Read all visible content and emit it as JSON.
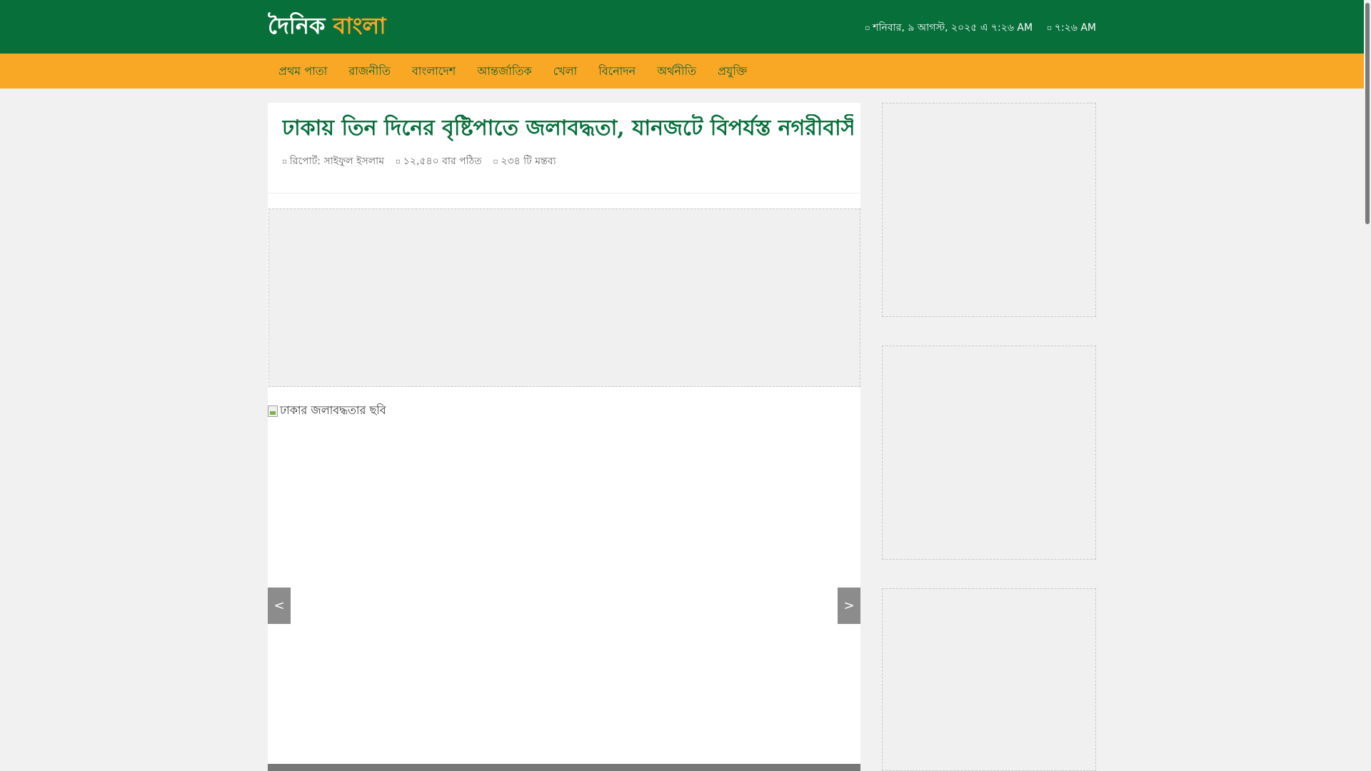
{
  "header": {
    "logo": {
      "part1": "দৈনিক",
      "part2": "বাংলা"
    },
    "date": "শনিবার, ৯ আগস্ট, ২০২৫ এ ৭:২৬ AM",
    "time": "৭:২৬ AM",
    "date_icon": "calendar-icon",
    "time_icon": "clock-icon"
  },
  "nav": {
    "items": [
      "প্রথম পাতা",
      "রাজনীতি",
      "বাংলাদেশ",
      "আন্তর্জাতিক",
      "খেলা",
      "বিনোদন",
      "অর্থনীতি",
      "প্রযুক্তি"
    ]
  },
  "article": {
    "title": "ঢাকায় তিন দিনের বৃষ্টিপাতে জলাবদ্ধতা, যানজটে বিপর্যস্ত নগরীবাসী",
    "reporter": "রিপোর্ট: সাইফুল ইসলাম",
    "views": "১২,৫৪০ বার পঠিত",
    "comments": "২৩৪ টি মন্তব্য",
    "image_alt": "ঢাকার জলাবদ্ধতার ছবি"
  },
  "slider": {
    "prev_label": "<",
    "next_label": ">"
  },
  "colors": {
    "primary": "#066f3a",
    "accent": "#f9a825",
    "ad_bg": "#f0f0f0"
  }
}
